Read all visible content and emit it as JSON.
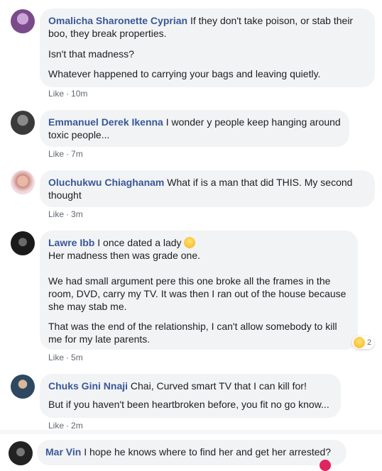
{
  "comments": [
    {
      "author": "Omalicha Sharonette Cyprian",
      "paragraphs": [
        "If they don't take poison, or stab their boo, they break properties.",
        "Isn't that madness?",
        "Whatever happened to carrying your bags and leaving quietly."
      ],
      "like_label": "Like",
      "time": "10m",
      "avatar_color": "#7a4a8a"
    },
    {
      "author": "Emmanuel Derek Ikenna",
      "paragraphs": [
        "I wonder y people keep hanging around toxic people..."
      ],
      "like_label": "Like",
      "time": "7m",
      "avatar_color": "#4a4a4a"
    },
    {
      "author": "Oluchukwu Chiaghanam",
      "paragraphs": [
        "What if is a man that did THIS. My second thought"
      ],
      "like_label": "Like",
      "time": "3m",
      "avatar_color": "#c98a78"
    },
    {
      "author": "Lawre Ibb",
      "first_line": "I once dated a lady",
      "second_line": "Her madness then was grade one.",
      "paragraphs": [
        "We had small argument pere this one broke all the frames in the room, DVD, carry my TV. It was then I ran out of the house because she may stab me.",
        "That was the end of the relationship, I can't allow somebody to kill me for my late parents."
      ],
      "reaction_count": "2",
      "like_label": "Like",
      "time": "5m",
      "avatar_color": "#2a2a2a"
    },
    {
      "author": "Chuks Gini Nnaji",
      "paragraphs": [
        "Chai, Curved smart TV that I can kill for!",
        "But if you haven't been heartbroken before, you fit no go know..."
      ],
      "like_label": "Like",
      "time": "2m",
      "avatar_color": "#3a5570"
    },
    {
      "author": "Mar Vin",
      "paragraphs": [
        "I hope he knows where to find her and get her arrested?"
      ],
      "avatar_color": "#333333"
    }
  ],
  "ui": {
    "dot": "·"
  }
}
